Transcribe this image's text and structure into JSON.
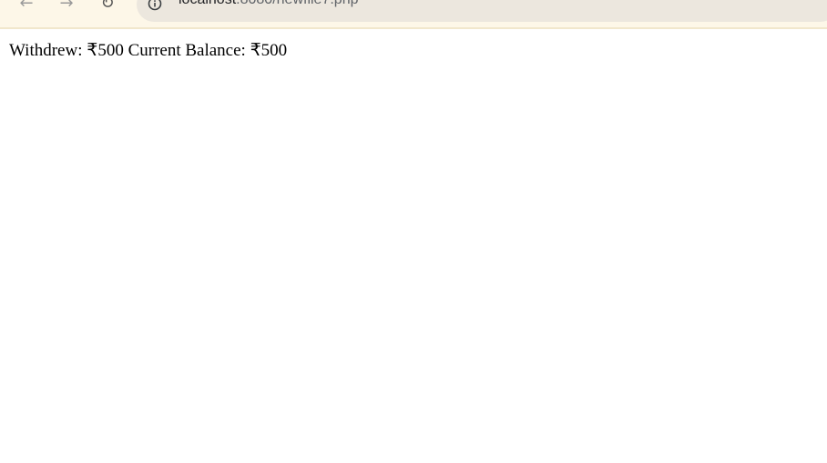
{
  "toolbar": {
    "back_icon": "←",
    "forward_icon": "→",
    "reload_icon": "↻",
    "address_bar": {
      "host": "localhost",
      "rest": ":8080/newfile7.php"
    }
  },
  "page": {
    "message": "Withdrew: ₹500 Current Balance: ₹500"
  }
}
